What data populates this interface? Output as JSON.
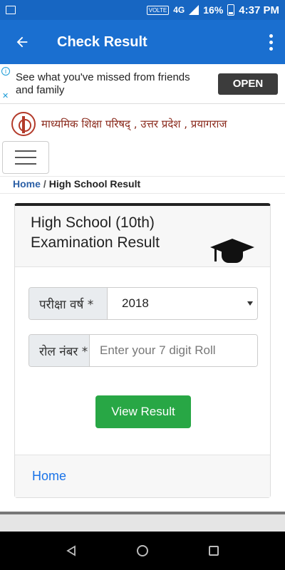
{
  "status_bar": {
    "volte": "VOLTE",
    "network": "4G",
    "battery_percent": "16%",
    "time": "4:37 PM"
  },
  "app_bar": {
    "title": "Check Result"
  },
  "ad": {
    "text_line1": "See what you've missed from friends",
    "text_line2": "and family",
    "button_label": "OPEN"
  },
  "org": {
    "name": "माध्यमिक शिक्षा परिषद् , उत्तर प्रदेश , प्रयागराज"
  },
  "breadcrumb": {
    "home": "Home",
    "separator": "/",
    "current": "High School Result"
  },
  "card": {
    "title_line1": "High School (10th)",
    "title_line2": "Examination Result",
    "year_label": "परीक्षा वर्ष *",
    "year_value": "2018",
    "roll_label": "रोल नंबर *",
    "roll_placeholder": "Enter your 7 digit Roll",
    "submit_label": "View Result",
    "footer_link": "Home"
  },
  "colors": {
    "app_bar": "#1a6fd0",
    "status_bar": "#1766c2",
    "button_green": "#28a745",
    "link_blue": "#1a73e8"
  },
  "icons": {
    "app_bar_back": "arrow-left-icon",
    "app_bar_menu": "more-vert-icon",
    "card_header": "graduation-cap-icon"
  }
}
